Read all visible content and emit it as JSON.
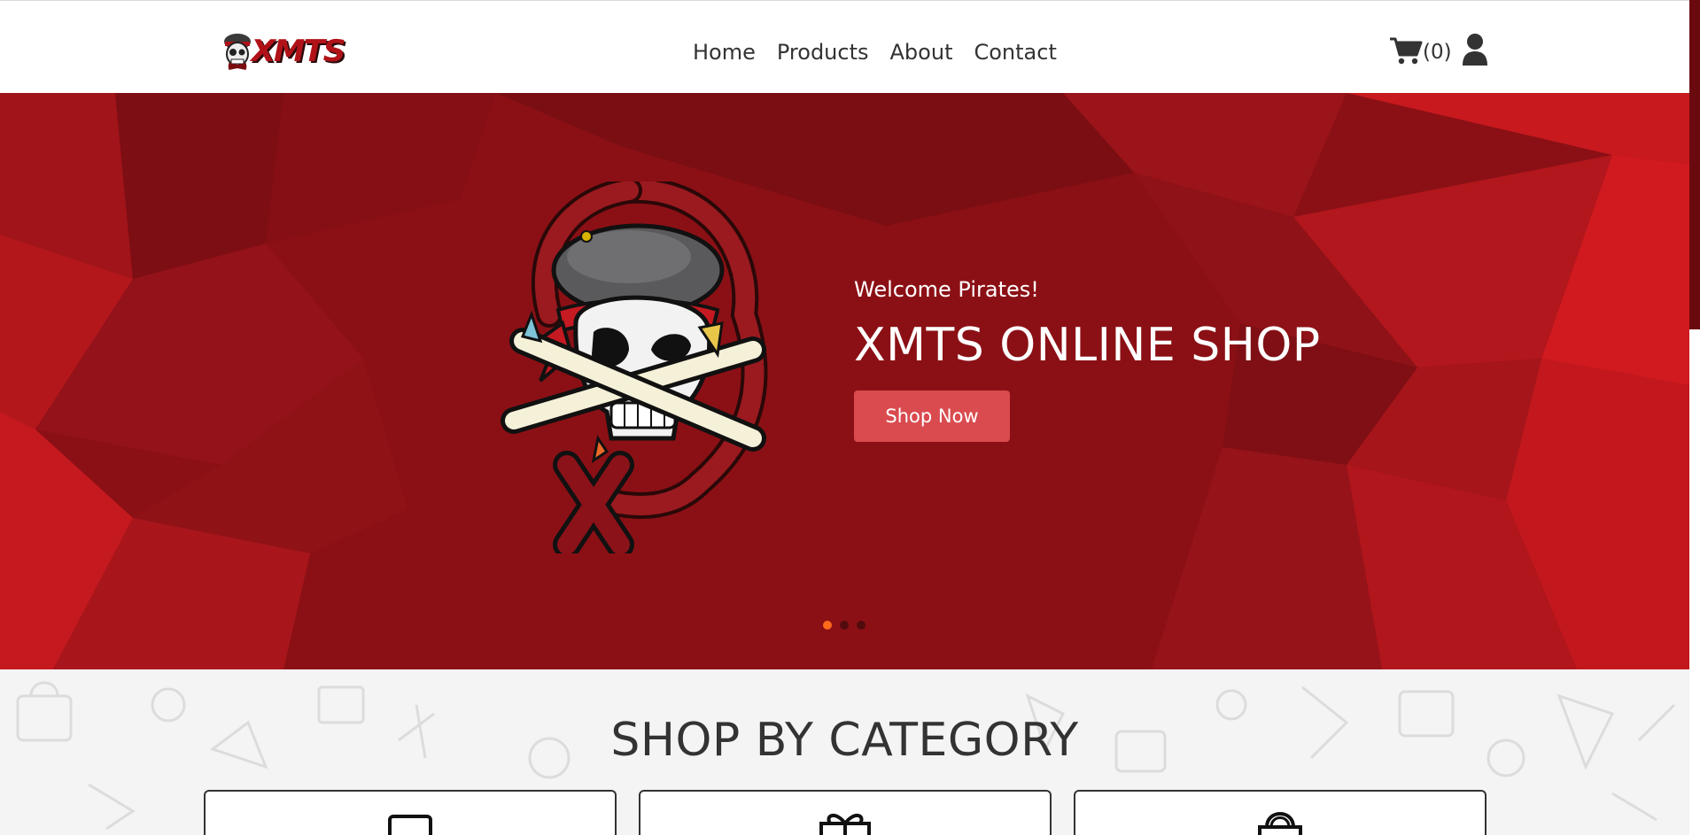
{
  "brand": {
    "logo_text": "XMTS"
  },
  "nav": {
    "items": [
      "Home",
      "Products",
      "About",
      "Contact"
    ]
  },
  "cart": {
    "count_label": "(0)"
  },
  "hero": {
    "subtitle": "Welcome Pirates!",
    "title": "XMTS ONLINE SHOP",
    "button_label": "Shop Now",
    "slide_count": 3,
    "active_slide": 1
  },
  "categories": {
    "title": "SHOP BY CATEGORY",
    "cards": [
      {
        "icon": "laptop-icon"
      },
      {
        "icon": "gift-icon"
      },
      {
        "icon": "shopping-bag-icon"
      }
    ]
  },
  "colors": {
    "brand_red": "#b01218",
    "hero_bg": "#8b1015",
    "button_bg": "#d94b4f",
    "active_dot": "#ff6a1a"
  }
}
